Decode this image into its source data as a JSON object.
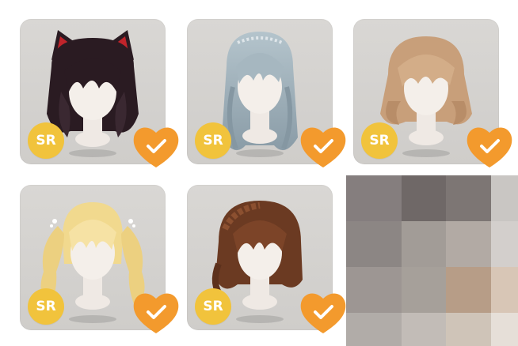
{
  "items": [
    {
      "name": "black-cat-ear-hair",
      "rarity": "SR",
      "hair_color": "#2a1b22",
      "accent": "#c0242b",
      "favorited": true
    },
    {
      "name": "silver-blue-wavy-hair",
      "rarity": "SR",
      "hair_color": "#9fb1bb",
      "accent": "#cfd8de",
      "favorited": true
    },
    {
      "name": "light-brown-bob-hair",
      "rarity": "SR",
      "hair_color": "#c89f7a",
      "accent": "#e0bd98",
      "favorited": true
    },
    {
      "name": "blonde-twin-tails-hair",
      "rarity": "SR",
      "hair_color": "#f1d98e",
      "accent": "#fbeab5",
      "favorited": true
    },
    {
      "name": "brown-braided-hair",
      "rarity": "SR",
      "hair_color": "#6b3a22",
      "accent": "#8c5030",
      "favorited": true
    }
  ],
  "colors": {
    "card_bg": "#d6d4d1",
    "badge": "#f1c33c",
    "heart": "#f39a2d",
    "check": "#ffffff"
  },
  "mosaic_colors": [
    [
      "#857e7e",
      "#6f6867",
      "#7d7674",
      "#c9c6c3"
    ],
    [
      "#8c8684",
      "#a29c97",
      "#b2aaa4",
      "#d3cfcc"
    ],
    [
      "#9d9693",
      "#a6a09a",
      "#b79d87",
      "#d8c6b6"
    ],
    [
      "#b1aca8",
      "#c2bcb7",
      "#cfc4b8",
      "#e6dfd8"
    ]
  ]
}
